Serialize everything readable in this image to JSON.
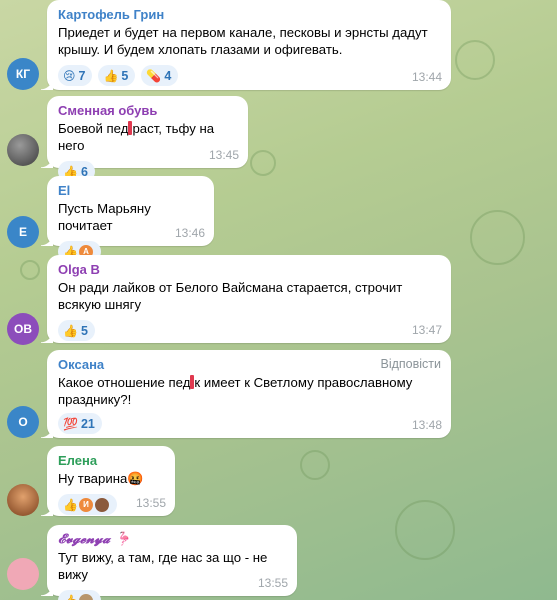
{
  "messages": [
    {
      "author": "Картофель Грин",
      "author_color": "#3f82c8",
      "avatar_initials": "КГ",
      "avatar_color": "#3a86c8",
      "text_parts": [
        "Приедет и будет на первом канале, песковы и эрнсты дадут крышу. И будем хлопать глазами и офигевать."
      ],
      "reactions": [
        {
          "icon": "crying-face-icon",
          "emoji": "😢",
          "count": "7"
        },
        {
          "icon": "thumbs-up-icon",
          "emoji": "👍",
          "count": "5"
        },
        {
          "icon": "pill-icon",
          "emoji": "💊",
          "count": "4"
        }
      ],
      "time": "13:44"
    },
    {
      "author": "Сменная обувь",
      "author_color": "#8e3fb2",
      "avatar_initials": "",
      "avatar_color": "#5a5a5a",
      "text_parts": [
        "Боевой пед",
        "раст, тьфу на него"
      ],
      "reactions": [
        {
          "icon": "thumbs-up-icon",
          "emoji": "👍",
          "count": "6"
        }
      ],
      "time": "13:45"
    },
    {
      "author": "El",
      "author_color": "#3f82c8",
      "avatar_initials": "E",
      "avatar_color": "#3a86c8",
      "text_parts": [
        "Пусть Марьяну почитает"
      ],
      "reactions": [
        {
          "icon": "thumbs-up-icon",
          "emoji": "👍",
          "count": ""
        }
      ],
      "time": "13:46"
    },
    {
      "author": "Olga B",
      "author_color": "#8e3fb2",
      "avatar_initials": "OB",
      "avatar_color": "#8c4dbb",
      "text_parts": [
        "Он ради лайков от Белого Вайсмана старается, строчит всякую шнягу"
      ],
      "reactions": [
        {
          "icon": "thumbs-up-icon",
          "emoji": "👍",
          "count": "5"
        }
      ],
      "time": "13:47"
    },
    {
      "author": "Оксана",
      "author_color": "#3f82c8",
      "avatar_initials": "O",
      "avatar_color": "#3a86c8",
      "text_parts": [
        "Какое отношение пед",
        "к имеет к Светлому православному празднику?!"
      ],
      "reply_label": "Відповісти",
      "reactions": [
        {
          "icon": "hundred-points-icon",
          "emoji": "💯",
          "count": "21"
        }
      ],
      "time": "13:48"
    },
    {
      "author": "Елена",
      "author_color": "#2e9e5a",
      "avatar_initials": "",
      "avatar_color": "#a0522d",
      "text_parts": [
        "Ну тварина🤬"
      ],
      "reactions": [
        {
          "icon": "thumbs-up-icon",
          "emoji": "👍",
          "count": ""
        }
      ],
      "reaction_avatar_letter": "И",
      "time": "13:55"
    },
    {
      "author": "𝓔𝓿𝓰𝓮𝓷𝔂𝓪 🦩",
      "author_color": "#8e3fb2",
      "avatar_initials": "",
      "avatar_color": "#f0a8b6",
      "text_parts": [
        "Тут вижу, а там, где нас за що - не вижу"
      ],
      "reactions": [
        {
          "icon": "thumbs-up-icon",
          "emoji": "👍",
          "count": ""
        }
      ],
      "time": "13:55"
    }
  ],
  "reactor_avatar_letter": "A"
}
